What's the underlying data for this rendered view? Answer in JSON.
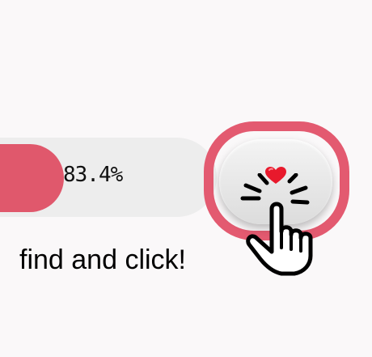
{
  "progress": {
    "value_label": "83.4%",
    "fill_fraction": 0.294
  },
  "like_button": {
    "icon": "heart-icon",
    "color": "#e0586c"
  },
  "overlay": {
    "pointer_icon": "hand-pointer-icon",
    "instruction": "find and click!"
  },
  "colors": {
    "accent": "#e0586c",
    "track": "#ededed",
    "background": "#faf8f9"
  }
}
